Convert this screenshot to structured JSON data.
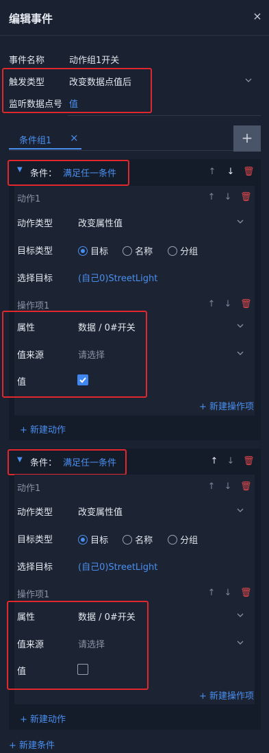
{
  "header": {
    "title": "编辑事件",
    "close_label": "×"
  },
  "event": {
    "name_label": "事件名称",
    "name_value": "动作组1开关",
    "trigger_label": "触发类型",
    "trigger_value": "改变数据点值后",
    "listen_label": "监听数据点号",
    "listen_value": "值"
  },
  "tabs": [
    {
      "label": "条件组1",
      "close": "×"
    }
  ],
  "add_tab_label": "+",
  "groups": [
    {
      "cond_label": "条件：",
      "cond_value": "满足任一条件",
      "action": {
        "title": "动作1",
        "type_label": "动作类型",
        "type_value": "改变属性值",
        "target_type_label": "目标类型",
        "options": [
          "目标",
          "名称",
          "分组"
        ],
        "selected": "目标",
        "select_target_label": "选择目标",
        "select_target_value": "(自己0)StreetLight",
        "op_title": "操作项1",
        "prop_label": "属性",
        "prop_value": "数据 / 0#开关",
        "src_label": "值来源",
        "src_placeholder": "请选择",
        "value_label": "值",
        "value_checked": true,
        "add_op": "+ 新建操作项"
      },
      "add_action": "+ 新建动作"
    },
    {
      "cond_label": "条件：",
      "cond_value": "满足任一条件",
      "action": {
        "title": "动作1",
        "type_label": "动作类型",
        "type_value": "改变属性值",
        "target_type_label": "目标类型",
        "options": [
          "目标",
          "名称",
          "分组"
        ],
        "selected": "目标",
        "select_target_label": "选择目标",
        "select_target_value": "(自己0)StreetLight",
        "op_title": "操作项1",
        "prop_label": "属性",
        "prop_value": "数据 / 0#开关",
        "src_label": "值来源",
        "src_placeholder": "请选择",
        "value_label": "值",
        "value_checked": false,
        "add_op": "+ 新建操作项"
      },
      "add_action": "+ 新建动作"
    }
  ],
  "add_condition": "+ 新建条件",
  "colors": {
    "accent": "#4a8ff0",
    "danger": "#e0474c",
    "highlight": "#e0282e"
  }
}
